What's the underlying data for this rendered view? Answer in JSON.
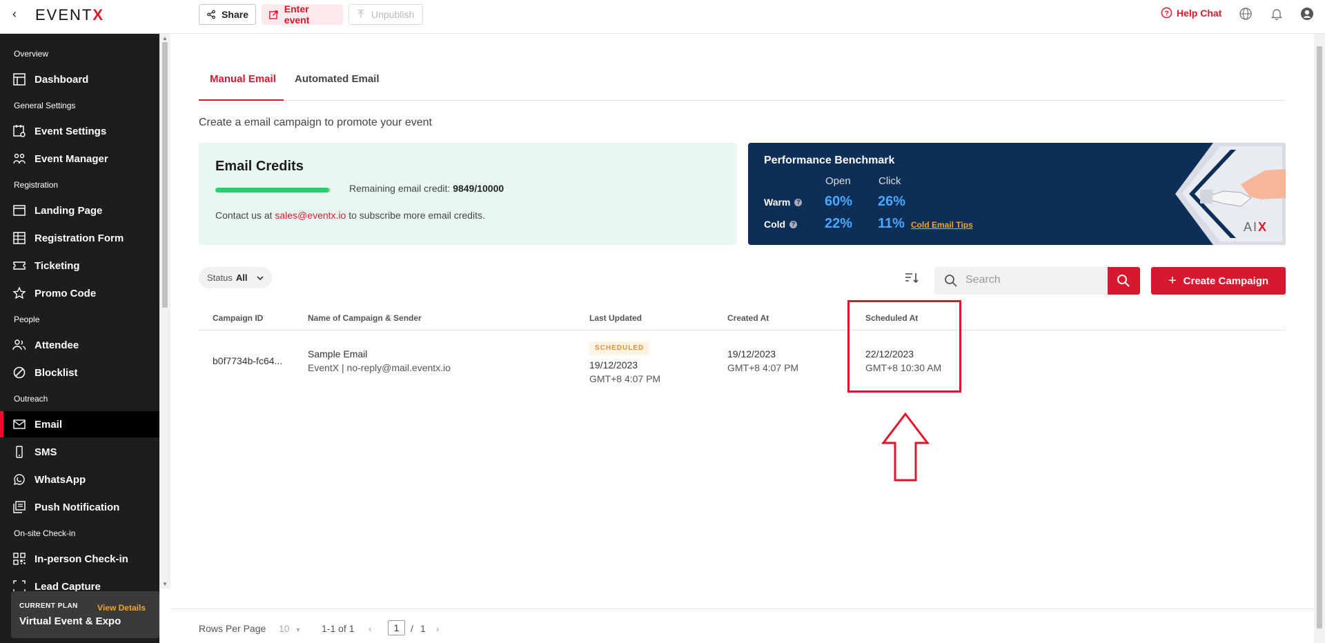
{
  "topbar": {
    "logo_text": "EVENT",
    "logo_x": "X",
    "share_label": "Share",
    "enter_label": "Enter event",
    "unpublish_label": "Unpublish",
    "help_label": "Help Chat"
  },
  "sidebar": {
    "sections": {
      "overview": "Overview",
      "general": "General Settings",
      "registration": "Registration",
      "people": "People",
      "outreach": "Outreach",
      "onsite": "On-site Check-in"
    },
    "items": {
      "dashboard": "Dashboard",
      "event_settings": "Event Settings",
      "event_manager": "Event Manager",
      "landing_page": "Landing Page",
      "registration_form": "Registration Form",
      "ticketing": "Ticketing",
      "promo_code": "Promo Code",
      "attendee": "Attendee",
      "blocklist": "Blocklist",
      "email": "Email",
      "sms": "SMS",
      "whatsapp": "WhatsApp",
      "push": "Push Notification",
      "checkin": "In-person Check-in",
      "lead": "Lead Capture"
    },
    "plan": {
      "label": "CURRENT PLAN",
      "link": "View Details",
      "name": "Virtual Event & Expo"
    }
  },
  "tabs": {
    "manual": "Manual Email",
    "automated": "Automated Email"
  },
  "subtitle": "Create a email campaign to promote your event",
  "credits": {
    "title": "Email Credits",
    "remaining_label": "Remaining email credit:",
    "remaining_value": "9849/10000",
    "remaining_fraction": 0.9849,
    "contact_prefix": "Contact us at",
    "contact_email": "sales@eventx.io",
    "contact_suffix": "to subscribe more email credits."
  },
  "benchmark": {
    "title": "Performance Benchmark",
    "col_open": "Open",
    "col_click": "Click",
    "warm_label": "Warm",
    "cold_label": "Cold",
    "warm_open": "60%",
    "warm_click": "26%",
    "cold_open": "22%",
    "cold_click": "11%",
    "tips_link": "Cold Email Tips",
    "ai_label": "AI"
  },
  "filters": {
    "status_label": "Status",
    "status_value": "All",
    "search_placeholder": "Search",
    "create_label": "Create Campaign"
  },
  "table": {
    "headers": {
      "id": "Campaign ID",
      "name": "Name of Campaign & Sender",
      "updated": "Last Updated",
      "created": "Created At",
      "scheduled": "Scheduled At"
    },
    "rows": [
      {
        "id": "b0f7734b-fc64...",
        "name": "Sample Email",
        "sender": "EventX | no-reply@mail.eventx.io",
        "status": "SCHEDULED",
        "updated_date": "19/12/2023",
        "updated_time": "GMT+8 4:07 PM",
        "created_date": "19/12/2023",
        "created_time": "GMT+8 4:07 PM",
        "scheduled_date": "22/12/2023",
        "scheduled_time": "GMT+8 10:30 AM"
      }
    ]
  },
  "pagination": {
    "rows_label": "Rows Per Page",
    "rows_value": "10",
    "range": "1-1 of 1",
    "current_page": "1",
    "separator": "/",
    "total_pages": "1"
  },
  "colors": {
    "brand_red": "#e3132b",
    "progress_green": "#2ecc71",
    "benchmark_bg": "#0d2f57",
    "benchmark_value": "#4aa8ff",
    "scheduled_badge": "#f0902a"
  }
}
